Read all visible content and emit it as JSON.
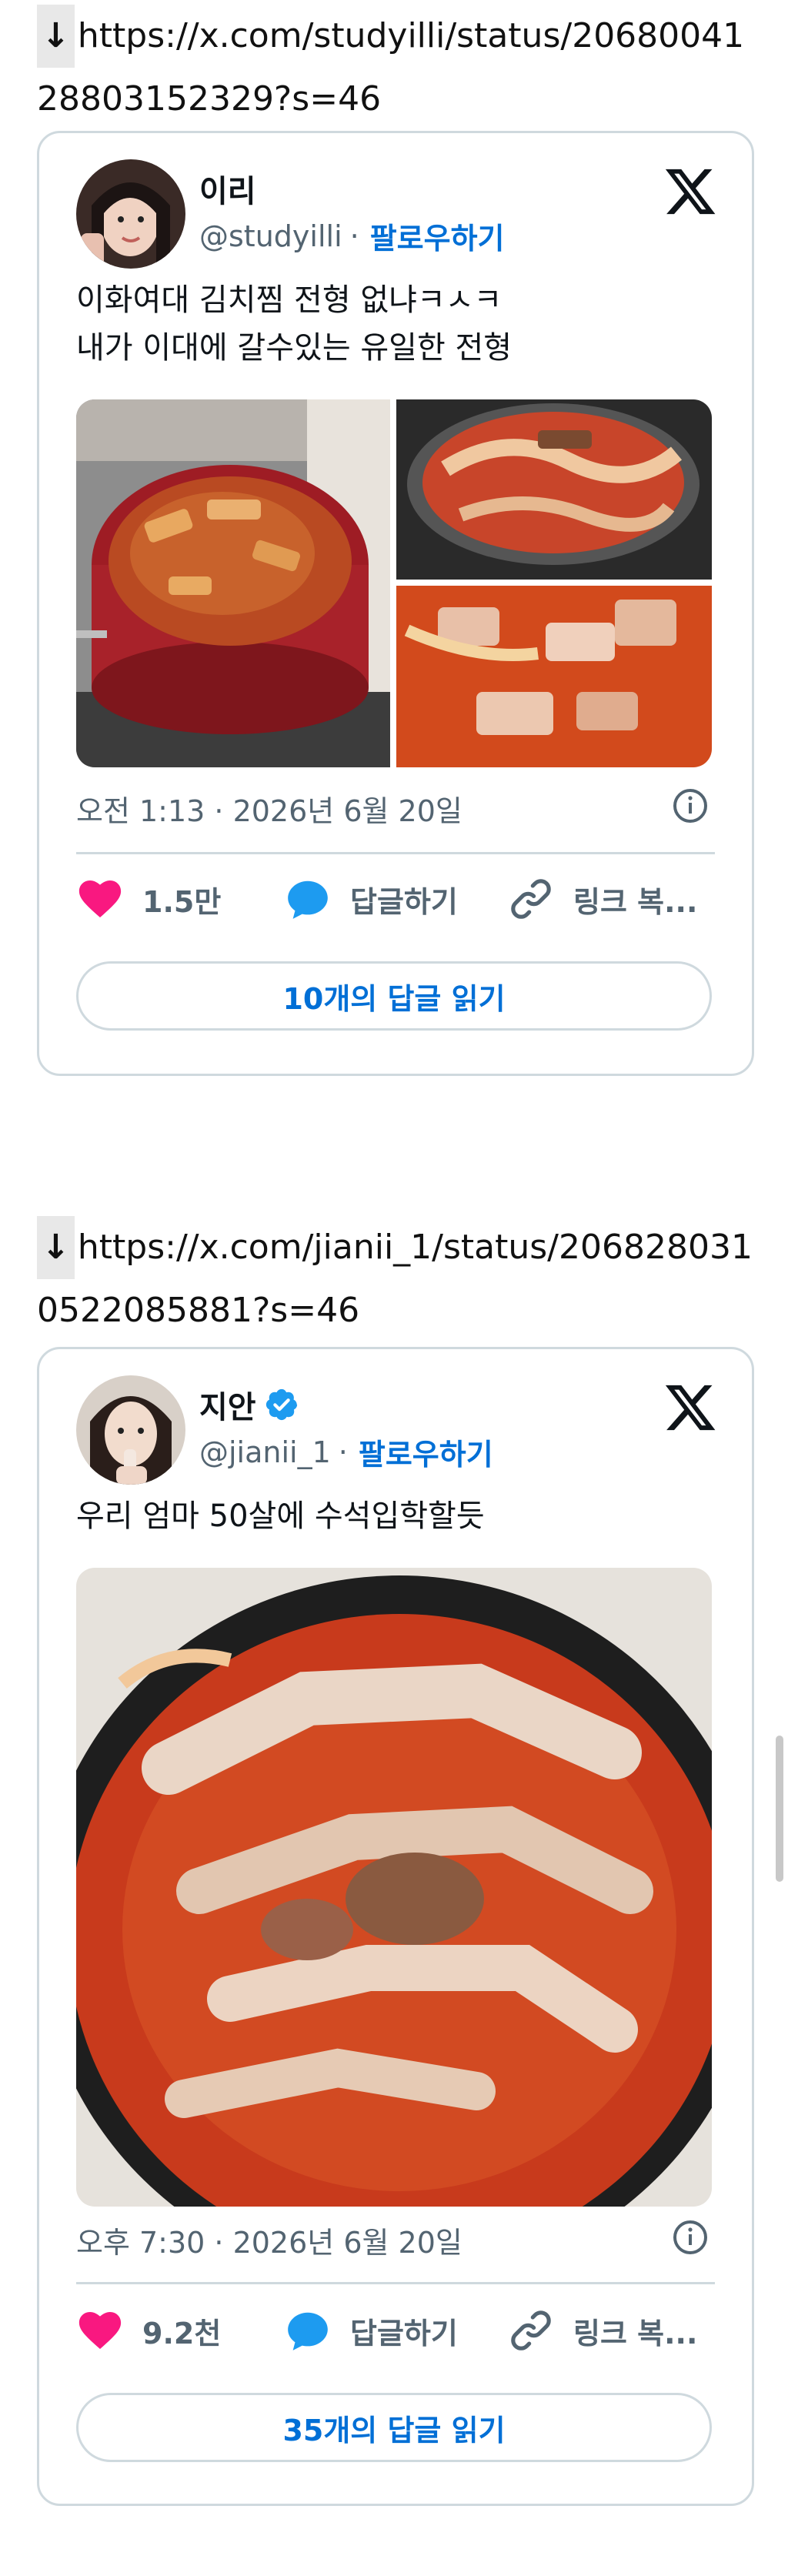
{
  "posts": [
    {
      "url_text": "https://x.com/studyilli/status/2068004128803152329?s=46",
      "arrow": "↓",
      "author": {
        "name": "이리",
        "handle": "@studyilli",
        "verified": false
      },
      "separator": "·",
      "follow_label": "팔로우하기",
      "text_lines": [
        "이화여대 김치찜 전형 없냐ㅋㅅㅋ",
        "내가 이대에 갈수있는 유일한 전형"
      ],
      "timestamp": "오전 1:13 · 2026년 6월 20일",
      "likes": "1.5만",
      "reply_label": "답글하기",
      "copy_link_label": "링크 복...",
      "read_replies_label": "10개의 답글 읽기"
    },
    {
      "url_text": "https://x.com/jianii_1/status/2068280310522085881?s=46",
      "arrow": "↓",
      "author": {
        "name": "지안",
        "handle": "@jianii_1",
        "verified": true
      },
      "separator": "·",
      "follow_label": "팔로우하기",
      "text_lines": [
        "우리 엄마 50살에 수석입학할듯"
      ],
      "timestamp": "오후 7:30 · 2026년 6월 20일",
      "likes": "9.2천",
      "reply_label": "답글하기",
      "copy_link_label": "링크 복...",
      "read_replies_label": "35개의 답글 읽기"
    }
  ],
  "colors": {
    "like": "#f91880",
    "reply": "#1d9bf0",
    "follow": "#006fd6",
    "border": "#cfd9de",
    "muted": "#536471"
  },
  "icons": [
    "down-arrow-icon",
    "x-logo-icon",
    "verified-badge-icon",
    "info-icon",
    "heart-icon",
    "reply-bubble-icon",
    "link-icon"
  ]
}
